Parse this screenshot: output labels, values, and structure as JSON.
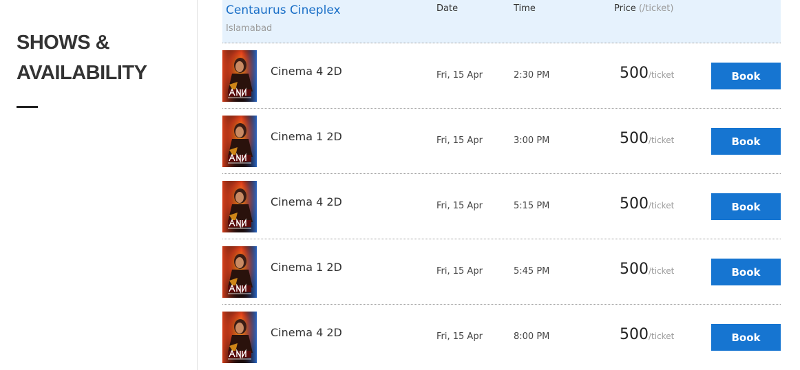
{
  "page": {
    "title_line1": "SHOWS &",
    "title_line2": "AVAILABILITY"
  },
  "venue": {
    "name": "Centaurus Cineplex",
    "city": "Islamabad"
  },
  "columns": {
    "date": "Date",
    "time": "Time",
    "price": "Price",
    "price_unit": "(/ticket)"
  },
  "shows": [
    {
      "screen": "Cinema 4 2D",
      "date": "Fri, 15 Apr",
      "time": "2:30 PM",
      "price": "500",
      "price_unit": "/ticket",
      "button": "Book"
    },
    {
      "screen": "Cinema 1 2D",
      "date": "Fri, 15 Apr",
      "time": "3:00 PM",
      "price": "500",
      "price_unit": "/ticket",
      "button": "Book"
    },
    {
      "screen": "Cinema 4 2D",
      "date": "Fri, 15 Apr",
      "time": "5:15 PM",
      "price": "500",
      "price_unit": "/ticket",
      "button": "Book"
    },
    {
      "screen": "Cinema 1 2D",
      "date": "Fri, 15 Apr",
      "time": "5:45 PM",
      "price": "500",
      "price_unit": "/ticket",
      "button": "Book"
    },
    {
      "screen": "Cinema 4 2D",
      "date": "Fri, 15 Apr",
      "time": "8:00 PM",
      "price": "500",
      "price_unit": "/ticket",
      "button": "Book"
    }
  ],
  "poster": {
    "icon": "movie-poster-fan",
    "colors": {
      "background": "#1a0b0b",
      "fire": "#e8431c",
      "glow": "#f7a41c",
      "blue": "#2b6fd6"
    }
  }
}
